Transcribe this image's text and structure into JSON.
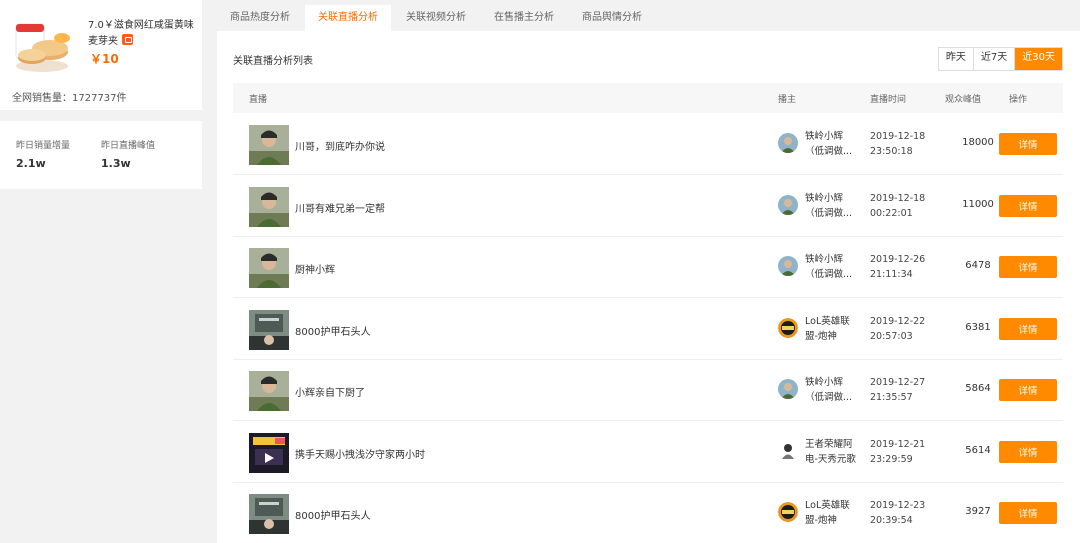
{
  "product": {
    "name": "7.0￥滋食网红咸蛋黄味麦芽夹",
    "price": "￥10",
    "total_sales": "全网销售量：1727737件"
  },
  "stats": [
    {
      "label": "昨日销量增量",
      "value": "2.1w"
    },
    {
      "label": "昨日直播峰值",
      "value": "1.3w"
    }
  ],
  "tabs": [
    {
      "label": "商品热度分析",
      "active": false
    },
    {
      "label": "关联直播分析",
      "active": true
    },
    {
      "label": "关联视频分析",
      "active": false
    },
    {
      "label": "在售播主分析",
      "active": false
    },
    {
      "label": "商品舆情分析",
      "active": false
    }
  ],
  "list_title": "关联直播分析列表",
  "ranges": [
    {
      "label": "昨天",
      "active": false
    },
    {
      "label": "近7天",
      "active": false
    },
    {
      "label": "近30天",
      "active": true
    }
  ],
  "table": {
    "headers": {
      "live": "直播",
      "anchor": "播主",
      "time": "直播时间",
      "peak": "观众峰值",
      "action": "操作"
    },
    "detail_label": "详情",
    "rows": [
      {
        "title": "川哥，到底咋办你说",
        "anchor_line1": "铁岭小辉",
        "anchor_line2": "（低调做...",
        "date": "2019-12-18",
        "clock": "23:50:18",
        "peak": "18000",
        "avatar": "person",
        "cover": "person"
      },
      {
        "title": "川哥有难兄弟一定帮",
        "anchor_line1": "铁岭小辉",
        "anchor_line2": "（低调做...",
        "date": "2019-12-18",
        "clock": "00:22:01",
        "peak": "11000",
        "avatar": "person",
        "cover": "person"
      },
      {
        "title": "厨神小辉",
        "anchor_line1": "铁岭小辉",
        "anchor_line2": "（低调做...",
        "date": "2019-12-26",
        "clock": "21:11:34",
        "peak": "6478",
        "avatar": "person",
        "cover": "person"
      },
      {
        "title": "8000护甲石头人",
        "anchor_line1": "LoL英雄联",
        "anchor_line2": "盟-炮神",
        "date": "2019-12-22",
        "clock": "20:57:03",
        "peak": "6381",
        "avatar": "lol",
        "cover": "room"
      },
      {
        "title": "小辉亲自下厨了",
        "anchor_line1": "铁岭小辉",
        "anchor_line2": "（低调做...",
        "date": "2019-12-27",
        "clock": "21:35:57",
        "peak": "5864",
        "avatar": "person",
        "cover": "person"
      },
      {
        "title": "携手天赐小拽浅汐守家两小时",
        "anchor_line1": "王者荣耀阿",
        "anchor_line2": "电-天秀元歌",
        "date": "2019-12-21",
        "clock": "23:29:59",
        "peak": "5614",
        "avatar": "game",
        "cover": "game"
      },
      {
        "title": "8000护甲石头人",
        "anchor_line1": "LoL英雄联",
        "anchor_line2": "盟-炮神",
        "date": "2019-12-23",
        "clock": "20:39:54",
        "peak": "3927",
        "avatar": "lol",
        "cover": "room"
      }
    ]
  }
}
